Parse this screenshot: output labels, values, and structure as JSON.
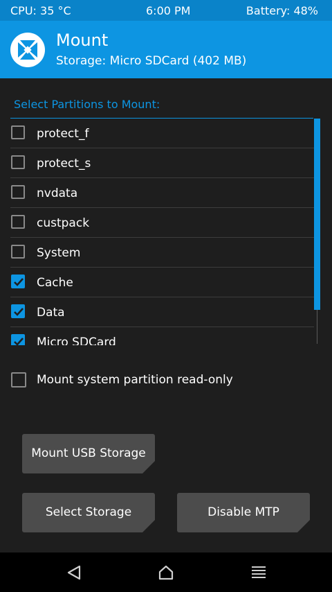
{
  "status": {
    "cpu": "CPU: 35 °C",
    "time": "6:00 PM",
    "battery": "Battery: 48%"
  },
  "header": {
    "title": "Mount",
    "subtitle": "Storage: Micro SDCard (402 MB)",
    "logo_icon": "twrp-logo-icon"
  },
  "section_label": "Select Partitions to Mount:",
  "partitions": [
    {
      "label": "protect_f",
      "checked": false
    },
    {
      "label": "protect_s",
      "checked": false
    },
    {
      "label": "nvdata",
      "checked": false
    },
    {
      "label": "custpack",
      "checked": false
    },
    {
      "label": "System",
      "checked": false
    },
    {
      "label": "Cache",
      "checked": true
    },
    {
      "label": "Data",
      "checked": true
    },
    {
      "label": "Micro SDCard",
      "checked": true
    }
  ],
  "readonly_option": {
    "label": "Mount system partition read-only",
    "checked": false
  },
  "buttons": {
    "mount_usb": "Mount USB Storage",
    "select_storage": "Select Storage",
    "disable_mtp": "Disable MTP"
  },
  "navbar": {
    "back_icon": "back-triangle-icon",
    "home_icon": "home-icon",
    "menu_icon": "menu-lines-icon"
  },
  "colors": {
    "accent": "#0d95e2",
    "status_bar": "#0a83c9",
    "background": "#1e1e1e",
    "button": "#4c4c4c"
  }
}
